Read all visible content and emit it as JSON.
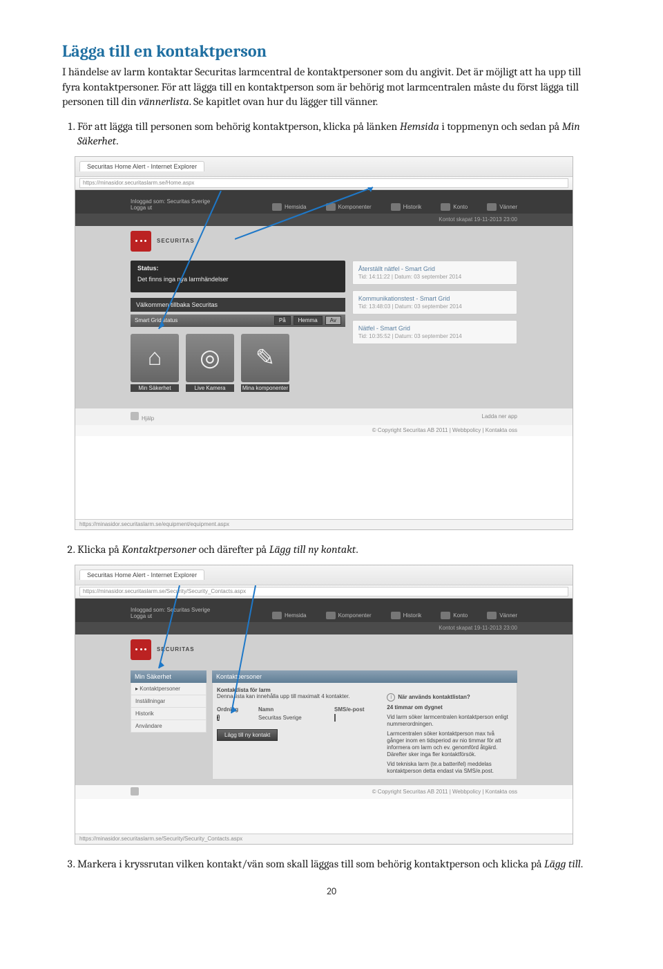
{
  "heading": "Lägga till en kontaktperson",
  "intro_part1": "I händelse av larm kontaktar Securitas larmcentral de kontaktpersoner som du angivit. Det är möjligt att ha upp till fyra kontaktpersoner. För att lägga till en kontaktperson som är behörig mot larmcentralen måste du först lägga till personen till din ",
  "intro_em": "vännerlista",
  "intro_part2": ". Se kapitlet ovan hur du lägger till vänner.",
  "step1_a": "För att lägga till personen som behörig kontaktperson, klicka på länken ",
  "step1_em1": "Hemsida",
  "step1_b": " i toppmenyn och sedan på ",
  "step1_em2": "Min Säkerhet",
  "step1_c": ".",
  "step2_a": "Klicka på ",
  "step2_em1": "Kontaktpersoner",
  "step2_b": " och därefter på ",
  "step2_em2": "Lägg till ny kontakt",
  "step2_c": ".",
  "step3_a": "Markera i kryssrutan vilken kontakt/vän som skall läggas till som behörig kontaktperson och klicka på ",
  "step3_em": "Lägg till",
  "step3_b": ".",
  "page_number": "20",
  "shot1": {
    "tab": "Securitas Home Alert - Internet Explorer",
    "url": "https://minasidor.securitaslarm.se/Home.aspx",
    "logged_in": "Inloggad som: Securitas Sverige",
    "logout": "Logga ut",
    "nav": {
      "hemsida": "Hemsida",
      "komponenter": "Komponenter",
      "historik": "Historik",
      "konto": "Konto",
      "vanner": "Vänner"
    },
    "created": "Kontot skapat 19-11-2013 23:00",
    "brand": "SECURITAS",
    "status_title": "Status:",
    "status_body": "Det finns inga nya larmhändelser",
    "welcome": "Välkommen tillbaka Securitas",
    "sg_title": "Smart Grid status",
    "sg_btns": {
      "pa": "På",
      "hemma": "Hemma",
      "av": "Av"
    },
    "tiles": {
      "sak": "Min Säkerhet",
      "kam": "Live Kamera",
      "komp": "Mina komponenter"
    },
    "events": [
      {
        "t": "Återställt nätfel - Smart Grid",
        "s": "Tid: 14:11:22  |  Datum: 03 september 2014"
      },
      {
        "t": "Kommunikationstest - Smart Grid",
        "s": "Tid: 13:48:03  |  Datum: 03 september 2014"
      },
      {
        "t": "Nätfel - Smart Grid",
        "s": "Tid: 10:35:52  |  Datum: 03 september 2014"
      }
    ],
    "hjalp": "Hjälp",
    "app": "Ladda ner app",
    "copyright": "© Copyright Securitas AB 2011  |  Webbpolicy  |  Kontakta oss",
    "status_url": "https://minasidor.securitaslarm.se/equipment/equipment.aspx"
  },
  "shot2": {
    "tab": "Securitas Home Alert - Internet Explorer",
    "url": "https://minasidor.securitaslarm.se/Security/Security_Contacts.aspx",
    "side_head": "Min Säkerhet",
    "side_items": [
      "Kontaktpersoner",
      "Inställningar",
      "Historik",
      "Användare"
    ],
    "cont_head": "Kontaktpersoner",
    "list_title": "Kontaktlista för larm",
    "list_note": "Denna lista kan innehålla upp till maximalt 4 kontakter.",
    "cols": {
      "ord": "Ordning",
      "name": "Namn",
      "sms": "SMS/e-post"
    },
    "row_name": "Securitas Sverige",
    "btn_add": "Lägg till ny kontakt",
    "info_title": "När används kontaktlistan?",
    "info_p1": "24 timmar om dygnet",
    "info_p2": "Vid larm söker larmcentralen kontaktperson enligt nummerordningen.",
    "info_p3": "Larmcentralen söker kontaktperson max två gånger inom en tidsperiod av nio timmar för att informera om larm och ev. genomförd åtgärd. Därefter sker inga fler kontaktförsök.",
    "info_p4": "Vid tekniska larm (te.a batterifel) meddelas kontaktperson detta endast via SMS/e.post.",
    "status_url": "https://minasidor.securitaslarm.se/Security/Security_Contacts.aspx"
  }
}
